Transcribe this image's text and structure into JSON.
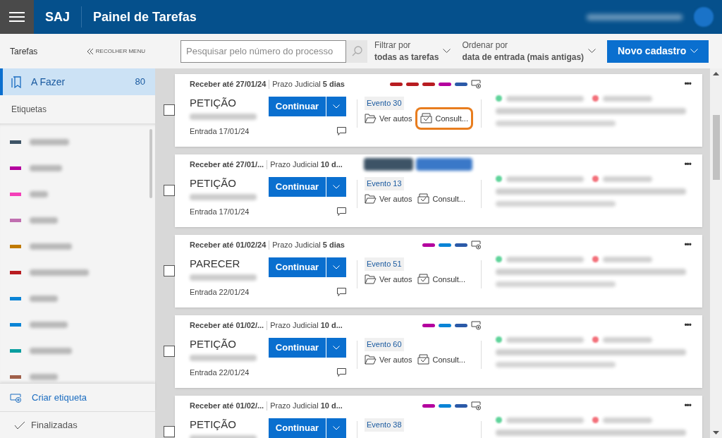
{
  "header": {
    "app": "SAJ",
    "title": "Painel de Tarefas"
  },
  "sidebar": {
    "heading": "Tarefas",
    "collapse": "RECOLHER MENU",
    "items": [
      {
        "label": "A Fazer",
        "count": "80",
        "selected": true
      }
    ],
    "labels_heading": "Etiquetas",
    "labels": [
      {
        "color": "#3d5366"
      },
      {
        "color": "#b4009e"
      },
      {
        "color": "#f43fb8"
      },
      {
        "color": "#c06fb0"
      },
      {
        "color": "#c07a00"
      },
      {
        "color": "#b81c21"
      },
      {
        "color": "#0a84d6"
      },
      {
        "color": "#0a84d6"
      },
      {
        "color": "#0a9ea0"
      },
      {
        "color": "#a0604a"
      }
    ],
    "create_label": "Criar etiqueta",
    "finished": "Finalizadas"
  },
  "toolbar": {
    "search": {
      "placeholder": "Pesquisar pelo número do processo"
    },
    "filter": {
      "label": "Filtrar por",
      "value": "todas as tarefas"
    },
    "sort": {
      "label": "Ordenar por",
      "value": "data de entrada (mais antigas)"
    },
    "new_button": "Novo cadastro"
  },
  "cards": [
    {
      "checked": false,
      "due": "Receber até 27/01/24",
      "deadline": "Prazo Judicial **5 dias**",
      "type": "PETIÇÃO",
      "entry": "Entrada 17/01/24",
      "event": "Evento 30",
      "continue": "Continuar",
      "view": "Ver autos",
      "consult": "Consult...",
      "consult_highlighted": true,
      "redacted_tags": false,
      "more": "•••",
      "tags": [
        {
          "color": "#b81c21"
        },
        {
          "color": "#b81c21"
        },
        {
          "color": "#b81c21"
        },
        {
          "color": "#b4009e"
        },
        {
          "color": "#2b5aa8"
        }
      ]
    },
    {
      "checked": false,
      "due": "Receber até 27/01/...",
      "deadline": "Prazo Judicial **10 d...**",
      "type": "PETIÇÃO",
      "entry": "Entrada 17/01/24",
      "event": "Evento 13",
      "continue": "Continuar",
      "view": "Ver autos",
      "consult": "Consult...",
      "consult_highlighted": false,
      "redacted_tags": true,
      "more": "•••"
    },
    {
      "checked": false,
      "due": "Receber até 01/02/24",
      "deadline": "Prazo Judicial **5 dias**",
      "type": "PARECER",
      "entry": "Entrada 22/01/24",
      "event": "Evento 51",
      "continue": "Continuar",
      "view": "Ver autos",
      "consult": "Consult...",
      "consult_highlighted": false,
      "redacted_tags": false,
      "more": "•••",
      "tags": [
        {
          "color": "#b4009e"
        },
        {
          "color": "#0a84d6"
        },
        {
          "color": "#2b5aa8"
        }
      ]
    },
    {
      "checked": false,
      "due": "Receber até 01/02/...",
      "deadline": "Prazo Judicial **10 d...**",
      "type": "PETIÇÃO",
      "entry": "Entrada 22/01/24",
      "event": "Evento 60",
      "continue": "Continuar",
      "view": "Ver autos",
      "consult": "Consult...",
      "consult_highlighted": false,
      "redacted_tags": false,
      "more": "•••",
      "tags": [
        {
          "color": "#b4009e"
        },
        {
          "color": "#0a84d6"
        },
        {
          "color": "#2b5aa8"
        }
      ]
    },
    {
      "checked": false,
      "due": "Receber até 01/02/...",
      "deadline": "Prazo Judicial **10 d...**",
      "type": "PETIÇÃO",
      "event": "Evento 38",
      "continue": "Continuar",
      "redacted_tags": false,
      "more": "•••",
      "tags": [
        {
          "color": "#b4009e"
        },
        {
          "color": "#0a84d6"
        },
        {
          "color": "#2b5aa8"
        }
      ]
    }
  ]
}
